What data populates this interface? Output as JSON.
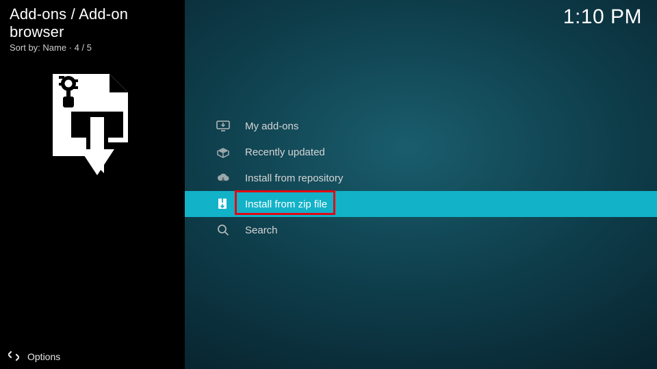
{
  "header": {
    "breadcrumb": "Add-ons / Add-on browser",
    "sort_line": "Sort by: Name  ·  4 / 5",
    "clock": "1:10 PM"
  },
  "menu": {
    "items": [
      {
        "label": "My add-ons",
        "icon": "monitor-download-icon",
        "selected": false
      },
      {
        "label": "Recently updated",
        "icon": "box-open-icon",
        "selected": false
      },
      {
        "label": "Install from repository",
        "icon": "cloud-download-icon",
        "selected": false
      },
      {
        "label": "Install from zip file",
        "icon": "zip-download-icon",
        "selected": true
      },
      {
        "label": "Search",
        "icon": "search-icon",
        "selected": false
      }
    ]
  },
  "footer": {
    "options_label": "Options"
  },
  "colors": {
    "highlight": "#12b2c8",
    "annotation": "#e30613"
  }
}
